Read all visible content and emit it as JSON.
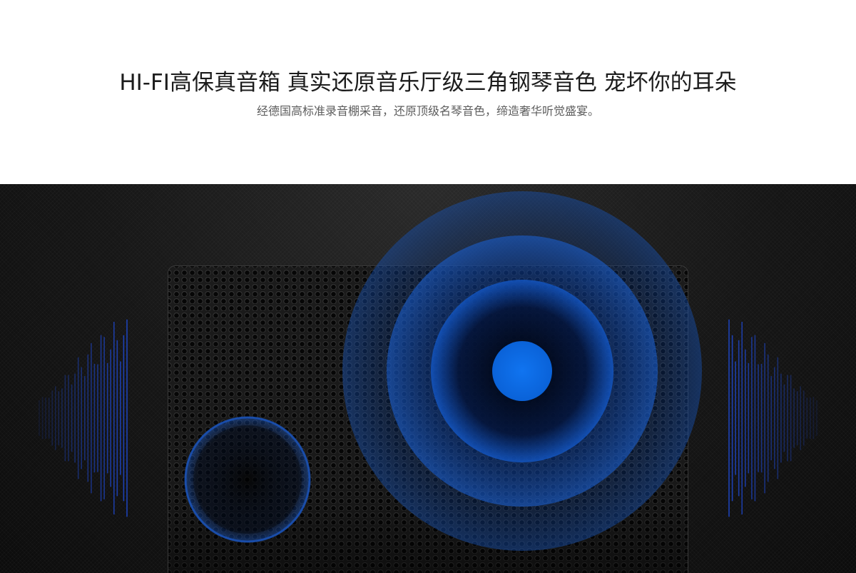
{
  "hero": {
    "headline": "HI-FI高保真音箱  真实还原音乐厅级三角钢琴音色  宠坏你的耳朵",
    "subline": "经德国高标准录音棚采音，还原顶级名琴音色，缔造奢华听觉盛宴。"
  },
  "colors": {
    "accent_blue": "#0a6ae0",
    "background_dark": "#141414"
  },
  "icons": {
    "left_wave": "sound-wave-icon",
    "right_wave": "sound-wave-icon"
  }
}
